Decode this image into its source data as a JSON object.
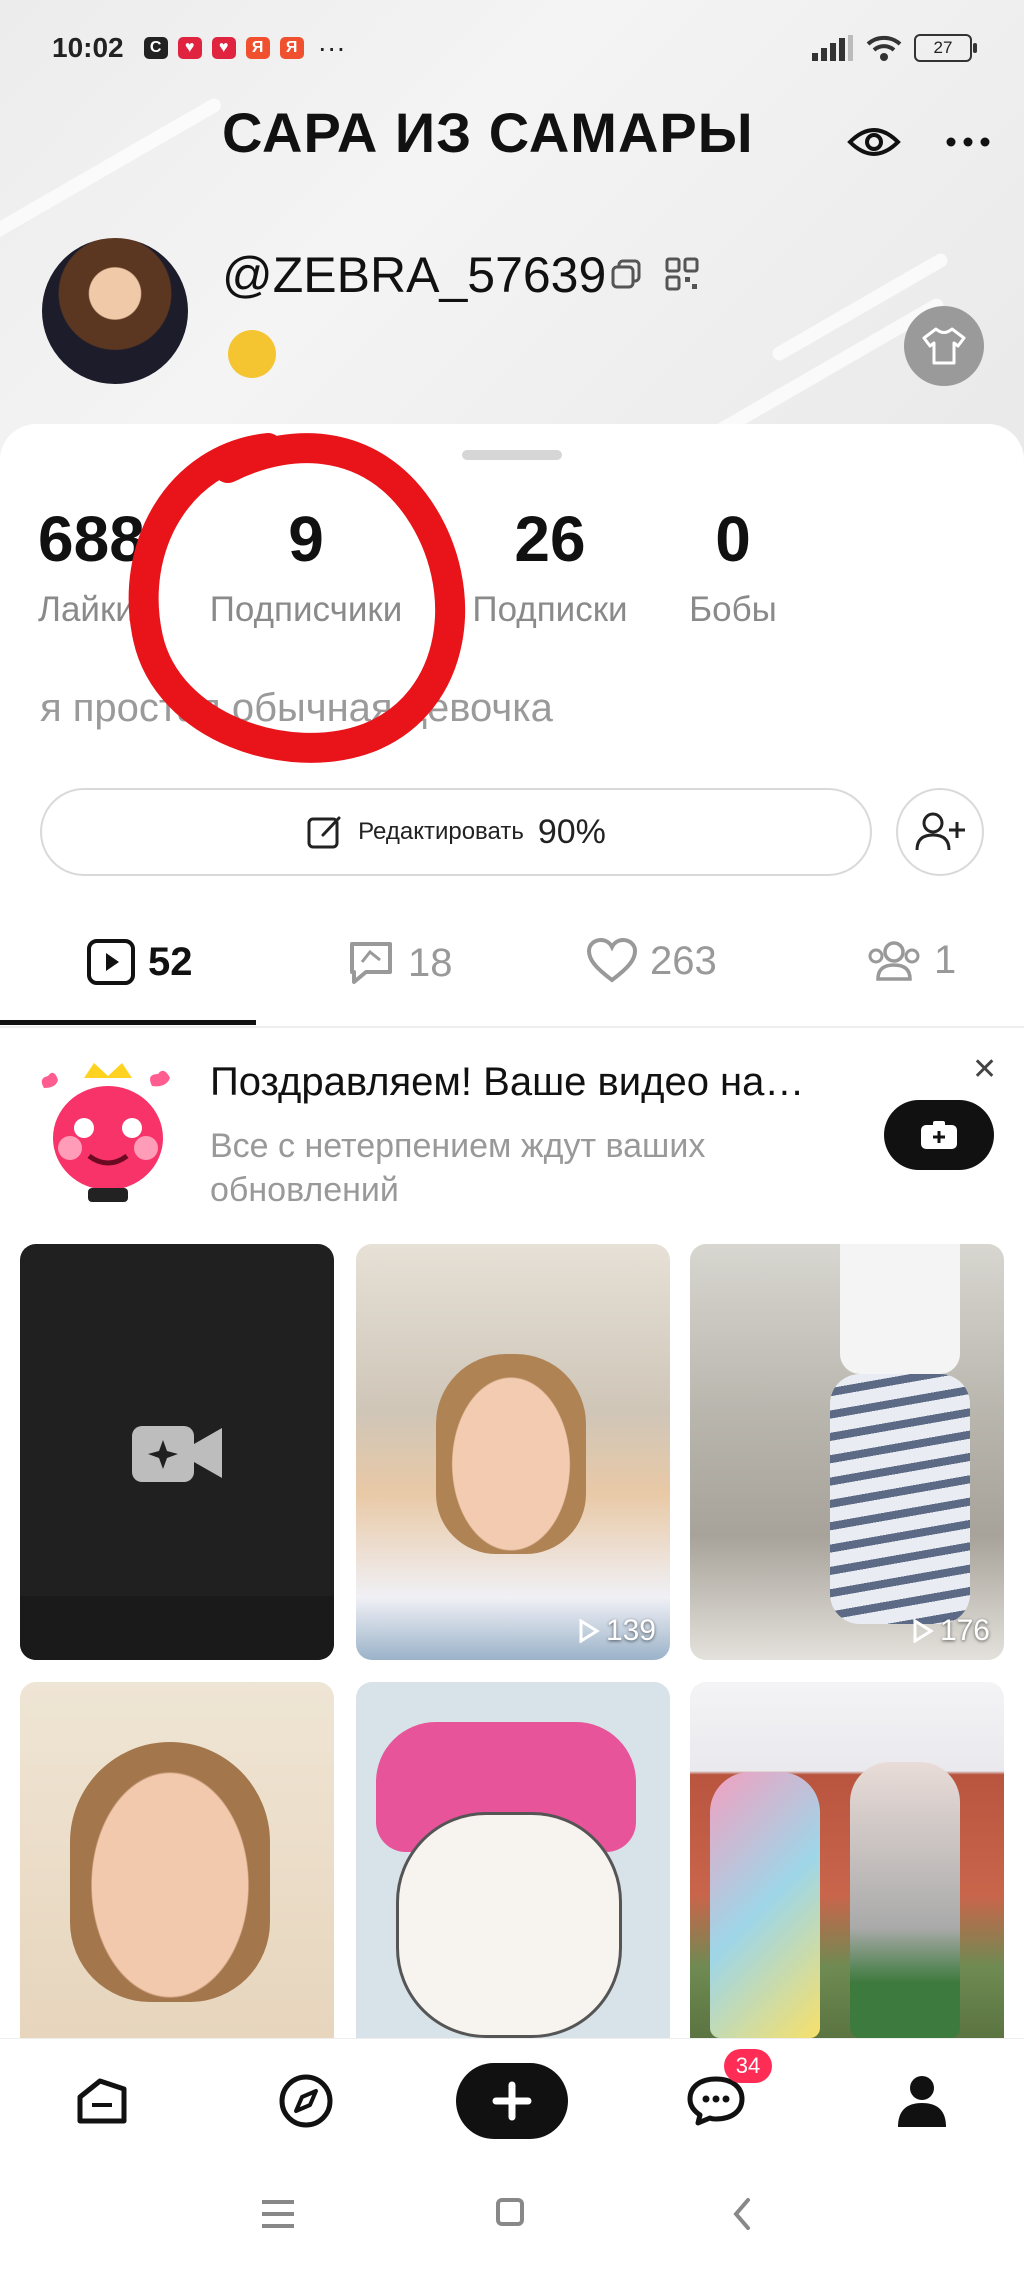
{
  "status_bar": {
    "time": "10:02",
    "notifications": [
      "С",
      "♥",
      "♥",
      "Я",
      "Я"
    ],
    "more": "···",
    "battery": "27"
  },
  "header": {
    "title": "САРА ИЗ САМАРЫ",
    "username": "@ZEBRA_57639"
  },
  "stats": [
    {
      "value": "688",
      "label": "Лайки"
    },
    {
      "value": "9",
      "label": "Подписчики"
    },
    {
      "value": "26",
      "label": "Подписки"
    },
    {
      "value": "0",
      "label": "Бобы"
    }
  ],
  "bio": "я простая обычная девочка",
  "edit": {
    "label": "Редактировать",
    "percent": "90%"
  },
  "tabs": [
    {
      "icon": "video-icon",
      "count": "52"
    },
    {
      "icon": "repost-icon",
      "count": "18"
    },
    {
      "icon": "heart-icon",
      "count": "263"
    },
    {
      "icon": "friends-icon",
      "count": "1"
    }
  ],
  "banner": {
    "title": "Поздравляем! Ваше видео на…",
    "subtitle": "Все с нетерпением ждут ваших обновлений"
  },
  "grid": [
    {
      "views": ""
    },
    {
      "views": "139"
    },
    {
      "views": "176"
    },
    {
      "views": ""
    },
    {
      "views": ""
    },
    {
      "views": ""
    }
  ],
  "bottom_nav": {
    "messages_badge": "34"
  },
  "colors": {
    "accent": "#111111",
    "badge": "#ff2d55",
    "annotation_red": "#e8141a"
  }
}
